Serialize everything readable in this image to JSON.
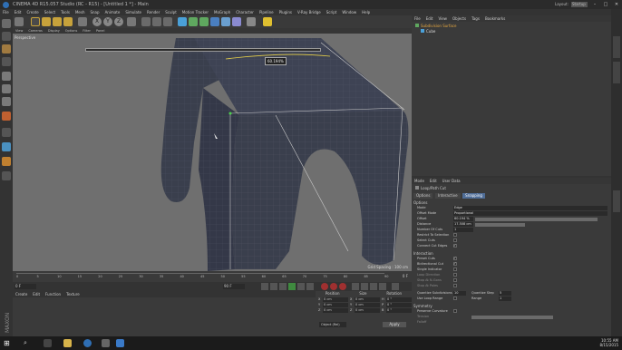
{
  "window": {
    "title": "CINEMA 4D R15.057 Studio (RC - R15) - [Untitled 1 *] - Main",
    "layout_label": "Layout:",
    "layout_value": "Startup"
  },
  "menubar": [
    "File",
    "Edit",
    "Create",
    "Select",
    "Tools",
    "Mesh",
    "Snap",
    "Animate",
    "Simulate",
    "Render",
    "Sculpt",
    "Motion Tracker",
    "MoGraph",
    "Character",
    "Pipeline",
    "Plugins",
    "V-Ray Bridge",
    "Script",
    "Window",
    "Help"
  ],
  "viewport": {
    "menu": [
      "View",
      "Cameras",
      "Display",
      "Options",
      "Filter",
      "Panel"
    ],
    "label": "Perspective",
    "grid_spacing": "Grid Spacing : 100 cm",
    "slider_value": "60.194%"
  },
  "timeline": {
    "ticks": [
      "0",
      "5",
      "10",
      "15",
      "20",
      "25",
      "30",
      "35",
      "40",
      "45",
      "50",
      "55",
      "60",
      "65",
      "70",
      "75",
      "80",
      "85",
      "90"
    ],
    "end_label": "0 F",
    "start_field": "0 F",
    "end_field": "90 F",
    "current": "0 F"
  },
  "material_manager": {
    "menu": [
      "Create",
      "Edit",
      "Function",
      "Texture"
    ]
  },
  "coordinates": {
    "headers": [
      "Position",
      "Size",
      "Rotation"
    ],
    "rows": [
      {
        "axis": "X",
        "pos": "0 cm",
        "size_axis": "X",
        "size": "0 cm",
        "rot_axis": "H",
        "rot": "0 °"
      },
      {
        "axis": "Y",
        "pos": "0 cm",
        "size_axis": "Y",
        "size": "0 cm",
        "rot_axis": "P",
        "rot": "0 °"
      },
      {
        "axis": "Z",
        "pos": "0 cm",
        "size_axis": "Z",
        "size": "0 cm",
        "rot_axis": "B",
        "rot": "0 °"
      }
    ],
    "mode": "Object (Rel)",
    "apply": "Apply"
  },
  "object_manager": {
    "menu": [
      "File",
      "Edit",
      "View",
      "Objects",
      "Tags",
      "Bookmarks"
    ],
    "objects": [
      "Subdivision Surface",
      "Cube"
    ]
  },
  "attributes": {
    "menu": [
      "Mode",
      "Edit",
      "User Data"
    ],
    "tool_name": "Loop/Path Cut",
    "tabs": [
      "Options",
      "Interactive",
      "Snapping"
    ],
    "active_tab": "Options",
    "sections": {
      "options": "Options",
      "interaction": "Interaction",
      "symmetry": "Symmetry"
    },
    "options": [
      {
        "label": "Mode",
        "value": "Edge"
      },
      {
        "label": "Offset Mode",
        "value": "Proportional"
      },
      {
        "label": "Offset",
        "value": "60.194 %"
      },
      {
        "label": "Distance",
        "value": "17.508 cm"
      },
      {
        "label": "Number Of Cuts",
        "value": "1"
      },
      {
        "label": "Restrict To Selection",
        "value": ""
      },
      {
        "label": "Select Cuts",
        "value": ""
      },
      {
        "label": "Connect Cut Edges",
        "value": ""
      }
    ],
    "interaction": [
      {
        "label": "Preset Cuts",
        "value": ""
      },
      {
        "label": "Bidirectional Cut",
        "value": ""
      },
      {
        "label": "Single Indicator",
        "value": ""
      },
      {
        "label": "Loop Direction",
        "value": ""
      },
      {
        "label": "Stop At N-Gons",
        "value": ""
      },
      {
        "label": "Stop At Poles",
        "value": ""
      }
    ],
    "quantize_subdivisions_label": "Quantize Subdivisions",
    "quantize_subdivisions_value": "10",
    "quantize_step_label": "Quantize Step",
    "quantize_step_value": "5",
    "use_loop_range_label": "Use Loop Range",
    "range_label": "Range",
    "range_value": "1",
    "symmetry_rows": [
      "Preserve Curvature",
      "Tension",
      "Falloff"
    ]
  },
  "taskbar": {
    "time": "10:55 AM",
    "date": "8/15/2015"
  },
  "colors": {
    "accent_tab": "#4f6d97",
    "model_mesh": "#3a3f4d",
    "viewport_bg": "#6f6f6f"
  }
}
